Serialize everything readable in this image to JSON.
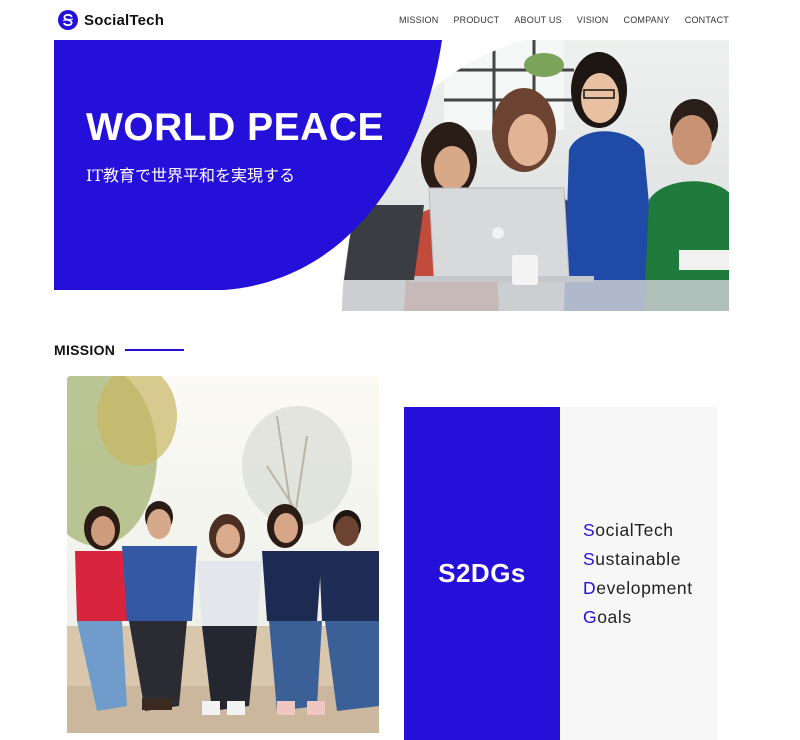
{
  "header": {
    "logo_text": "SocialTech",
    "nav": [
      "MISSION",
      "PRODUCT",
      "ABOUT US",
      "VISION",
      "COMPANY",
      "CONTACT"
    ]
  },
  "hero": {
    "title": "WORLD PEACE",
    "subtitle": "IT教育で世界平和を実現する"
  },
  "mission": {
    "heading": "MISSION",
    "card": {
      "title": "S2DGs",
      "items": [
        {
          "initial": "S",
          "rest": "ocialTech"
        },
        {
          "initial": "S",
          "rest": "ustainable"
        },
        {
          "initial": "D",
          "rest": "evelopment"
        },
        {
          "initial": "G",
          "rest": "oals"
        }
      ]
    }
  },
  "colors": {
    "brand": "#2410d8",
    "card_bg": "#f7f7f7"
  },
  "icons": [
    "logo-mark-icon"
  ]
}
